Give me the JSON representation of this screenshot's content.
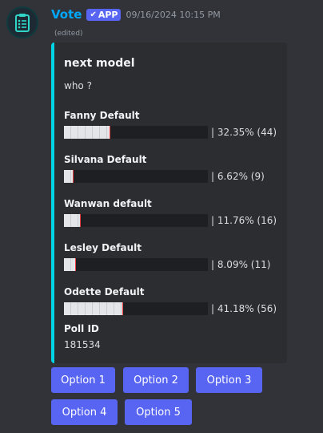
{
  "message": {
    "author": "Vote",
    "badge": "APP",
    "timestamp": "09/16/2024 10:15 PM",
    "edited": "(edited)",
    "avatar_icon": "clipboard-checklist-icon"
  },
  "embed": {
    "accent_color": "#00d5e6",
    "title": "next model",
    "description": "who ?",
    "options": [
      {
        "name": "Fanny Default",
        "result": "| 32.35% (44)",
        "fraction": 0.3235
      },
      {
        "name": "Silvana Default",
        "result": "| 6.62% (9)",
        "fraction": 0.0662
      },
      {
        "name": "Wanwan default",
        "result": "| 11.76% (16)",
        "fraction": 0.1176
      },
      {
        "name": "Lesley Default",
        "result": "| 8.09% (11)",
        "fraction": 0.0809
      },
      {
        "name": "Odette Default",
        "result": "| 41.18% (56)",
        "fraction": 0.4118
      }
    ],
    "poll_id_label": "Poll ID",
    "poll_id_value": "181534"
  },
  "buttons": [
    "Option 1",
    "Option 2",
    "Option 3",
    "Option 4",
    "Option 5"
  ],
  "colors": {
    "background": "#313338",
    "button": "#5865f2",
    "username": "#00a8fc"
  }
}
